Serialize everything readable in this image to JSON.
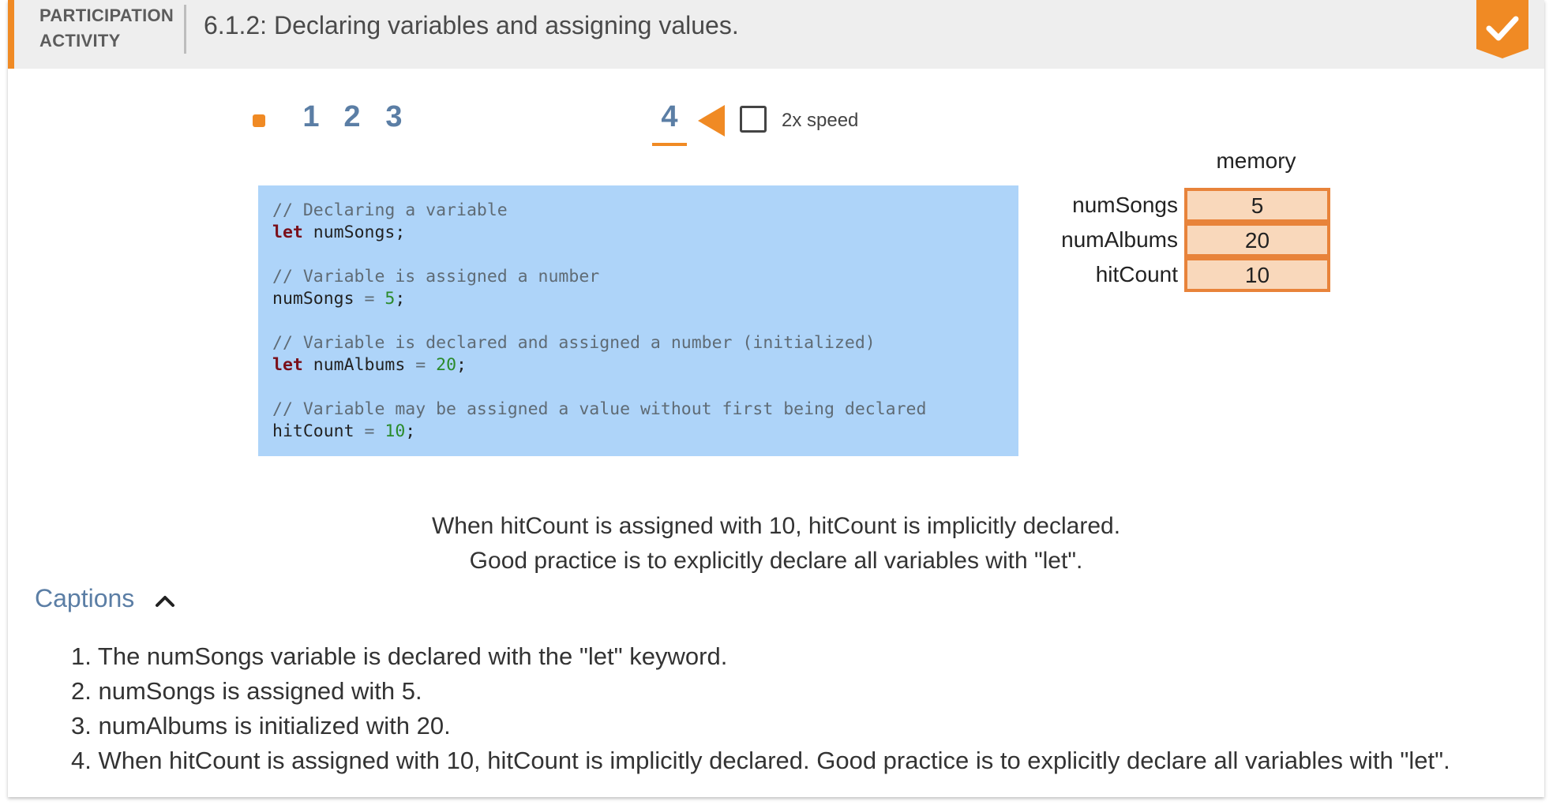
{
  "header": {
    "participation_line1": "PARTICIPATION",
    "participation_line2": "ACTIVITY",
    "title": "6.1.2: Declaring variables and assigning values.",
    "completed_icon": "checkmark-icon",
    "accent_color": "#f08a24"
  },
  "controls": {
    "steps": [
      "1",
      "2",
      "3",
      "4"
    ],
    "active_step": "4",
    "speed_label": "2x speed",
    "speed_checked": false
  },
  "code": {
    "c1": "// Declaring a variable",
    "l1_kw": "let",
    "l1_rest": " numSongs;",
    "c2": "// Variable is assigned a number",
    "l2_name": "numSongs ",
    "l2_eq": "=",
    "l2_num": "5",
    "l2_semi": ";",
    "c3": "// Variable is declared and assigned a number (initialized)",
    "l3_kw": "let",
    "l3_name": " numAlbums ",
    "l3_eq": "=",
    "l3_num": "20",
    "l3_semi": ";",
    "c4": "// Variable may be assigned a value without first being declared",
    "l4_name": "hitCount ",
    "l4_eq": "=",
    "l4_num": "10",
    "l4_semi": ";"
  },
  "memory": {
    "title": "memory",
    "rows": [
      {
        "name": "numSongs",
        "value": "5"
      },
      {
        "name": "numAlbums",
        "value": "20"
      },
      {
        "name": "hitCount",
        "value": "10"
      }
    ]
  },
  "current_caption": {
    "line1": "When hitCount is assigned with 10, hitCount is implicitly declared.",
    "line2": "Good practice is to explicitly declare all variables with \"let\"."
  },
  "captions": {
    "label": "Captions",
    "items": [
      "1. The numSongs variable is declared with the \"let\" keyword.",
      "2. numSongs is assigned with 5.",
      "3. numAlbums is initialized with 20.",
      "4. When hitCount is assigned with 10, hitCount is implicitly declared. Good practice is to explicitly declare all variables with \"let\"."
    ]
  }
}
